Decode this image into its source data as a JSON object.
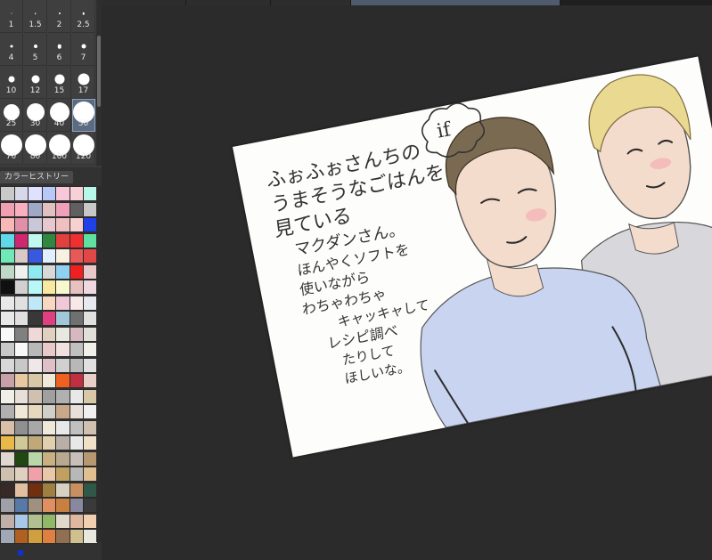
{
  "brush_sizes": {
    "items": [
      {
        "label": "1",
        "dot": 1
      },
      {
        "label": "1.5",
        "dot": 1.5
      },
      {
        "label": "2",
        "dot": 2
      },
      {
        "label": "2.5",
        "dot": 2.5
      },
      {
        "label": "4",
        "dot": 3
      },
      {
        "label": "5",
        "dot": 4
      },
      {
        "label": "6",
        "dot": 4.5
      },
      {
        "label": "7",
        "dot": 5
      },
      {
        "label": "10",
        "dot": 7
      },
      {
        "label": "12",
        "dot": 9
      },
      {
        "label": "15",
        "dot": 11
      },
      {
        "label": "17",
        "dot": 13
      },
      {
        "label": "25",
        "dot": 18
      },
      {
        "label": "30",
        "dot": 20
      },
      {
        "label": "40",
        "dot": 22
      },
      {
        "label": "50",
        "dot": 24
      },
      {
        "label": "70",
        "dot": 24
      },
      {
        "label": "80",
        "dot": 24
      },
      {
        "label": "100",
        "dot": 24
      },
      {
        "label": "120",
        "dot": 24
      }
    ],
    "selected": "50"
  },
  "color_history": {
    "title": "カラーヒストリー",
    "swatches": [
      [
        "#c9c9c9",
        "#d8d8e8",
        "#e0e0ff",
        "#b8c8f8",
        "#f8c8d8",
        "#f8d0d8",
        "#b8f8e8"
      ],
      [
        "#f0a0b0",
        "#f8b0c0",
        "#a0a8c8",
        "#e0c0c0",
        "#f0a0b8",
        "#606060",
        "#c8c8c8"
      ],
      [
        "#f8b8b8",
        "#e090a8",
        "#c8c8d8",
        "#e8c8d0",
        "#f0c0c0",
        "#f8d0d0",
        "#2040e8"
      ],
      [
        "#60d8e8",
        "#d02870",
        "#c0f8f0",
        "#308840",
        "#e04040",
        "#f03030",
        "#60e0a0"
      ],
      [
        "#70e8b8",
        "#d8c8c8",
        "#3858e0",
        "#e0f0ff",
        "#f8f0e0",
        "#e85858",
        "#e04848"
      ],
      [
        "#c0d8c8",
        "#f0f0f0",
        "#90e8f0",
        "#d8d8d8",
        "#90d0f0",
        "#f02020",
        "#e8c8c8"
      ],
      [
        "#101010",
        "#d0d0d0",
        "#b8f8f8",
        "#f8e8a0",
        "#f8f8d0",
        "#e8c0c0",
        "#f0d8e0"
      ],
      [
        "#e8e8e8",
        "#e0e0e0",
        "#c0e8f8",
        "#f8d8c0",
        "#f0c8d8",
        "#f8e8e8",
        "#e8e8f0"
      ],
      [
        "#e8e8e8",
        "#e0e0e0",
        "#383838",
        "#e04080",
        "#a0c8d8",
        "#707070",
        "#e0e0e0"
      ],
      [
        "#f8f8f8",
        "#808080",
        "#f0d8d8",
        "#e0d0c0",
        "#e8e8e0",
        "#d8b8c0",
        "#e0e0d8"
      ],
      [
        "#c8c8c8",
        "#f8f8f8",
        "#b8b8b8",
        "#e8c8c8",
        "#f0e0e0",
        "#c0c0c0",
        "#f0f0e8"
      ],
      [
        "#d8d8d8",
        "#c8c8c8",
        "#f0e8e8",
        "#e0c0c8",
        "#d0d0d0",
        "#b8b8b8",
        "#e0e0e0"
      ],
      [
        "#c8a0a8",
        "#e8c8a0",
        "#d8c8a8",
        "#f0e8d8",
        "#f06020",
        "#c03040",
        "#e8d0c8"
      ],
      [
        "#f0f0e8",
        "#e8e0d8",
        "#d0c0b0",
        "#a0a0a0",
        "#b0b0b0",
        "#e8e8e8",
        "#d8c8a8"
      ],
      [
        "#b0b0b0",
        "#f0e8d8",
        "#e8d8c0",
        "#d0d0c8",
        "#c8a888",
        "#e8e0d8",
        "#f0f0f0"
      ],
      [
        "#d8c0a8",
        "#909090",
        "#a8a8a8",
        "#f0e8d8",
        "#e8e8e8",
        "#c0c0c0",
        "#d0c0b0"
      ],
      [
        "#e8b848",
        "#d0c898",
        "#c0a878",
        "#e0d0b0",
        "#b8b0a8",
        "#e8e8e8",
        "#f0e0c8"
      ],
      [
        "#e0d8d0",
        "#204810",
        "#b8d8a8",
        "#c8b080",
        "#b8a890",
        "#c8c0b8",
        "#b89870"
      ],
      [
        "#d0c0b0",
        "#e0d0c0",
        "#f0a0a8",
        "#e8c8a8",
        "#c0a060",
        "#b8b8b8",
        "#e0c090"
      ],
      [
        "#382828",
        "#e0c0a0",
        "#703010",
        "#a08040",
        "#d8d0c0",
        "#c89060",
        "#305848"
      ],
      [
        "#a0a0a8",
        "#5878a8",
        "#a09080",
        "#e09060",
        "#c88040",
        "#8888a0",
        "#3a3a3a"
      ],
      [
        "#c0b0a8",
        "#a8c8e8",
        "#b0c090",
        "#90b868",
        "#e0d8c8",
        "#e0b8a0",
        "#f0d0b0"
      ],
      [
        "#a0a8b8",
        "#b06020",
        "#d0a040",
        "#e08040",
        "#907050",
        "#d0c090",
        "#e8e8e0"
      ]
    ]
  },
  "document_tabs": [
    {
      "label": "",
      "active": false
    },
    {
      "label": "",
      "active": false
    },
    {
      "label": "",
      "active": false
    },
    {
      "label": "",
      "active": true
    }
  ],
  "artwork": {
    "bubble_text": "if",
    "note_lines": [
      "ふぉふぉさんちの",
      "うまそうなごはんを",
      "見ている",
      "マクダンさん。",
      "ほんやくソフトを",
      "使いながら",
      "わちゃわちゃ",
      "キャッキャして",
      "レシピ調べ",
      "たりして",
      "ほしいな。"
    ],
    "colors": {
      "paper": "#fdfdfb",
      "shirt_left": "#c8d4f0",
      "shirt_right": "#d8d8dc",
      "hair_left": "#7a6a52",
      "hair_right": "#e8d890",
      "skin": "#f4dccc",
      "blush": "#f4a8b0"
    }
  }
}
